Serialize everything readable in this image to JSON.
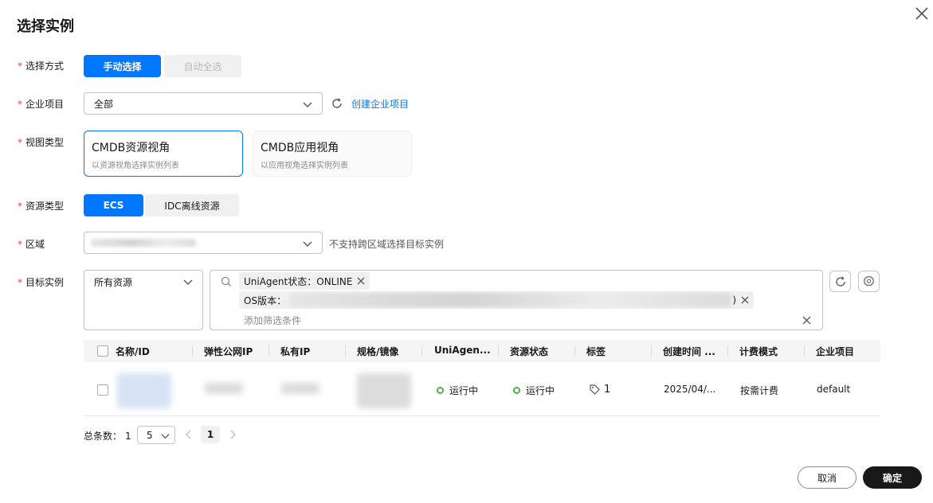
{
  "dialog": {
    "title": "选择实例"
  },
  "selection_mode": {
    "label": "选择方式",
    "options": [
      "手动选择",
      "自动全选"
    ],
    "selected": "手动选择"
  },
  "enterprise_project": {
    "label": "企业项目",
    "value": "全部",
    "create_link": "创建企业项目"
  },
  "view_type": {
    "label": "视图类型",
    "cards": [
      {
        "title": "CMDB资源视角",
        "desc": "以资源视角选择实例列表"
      },
      {
        "title": "CMDB应用视角",
        "desc": "以应用视角选择实例列表"
      }
    ],
    "selected": "CMDB资源视角"
  },
  "resource_type": {
    "label": "资源类型",
    "options": [
      "ECS",
      "IDC离线资源"
    ],
    "selected": "ECS"
  },
  "region": {
    "label": "区域",
    "hint": "不支持跨区域选择目标实例"
  },
  "target_instance": {
    "label": "目标实例",
    "resource_scope": "所有资源",
    "filters": [
      {
        "text": "UniAgent状态：ONLINE"
      },
      {
        "prefix": "OS版本：",
        "suffix": ")"
      }
    ],
    "add_filter_placeholder": "添加筛选条件"
  },
  "table": {
    "columns": [
      "名称/ID",
      "弹性公网IP",
      "私有IP",
      "规格/镜像",
      "UniAgen...",
      "资源状态",
      "标签",
      "创建时间 ...",
      "计费模式",
      "企业项目"
    ],
    "rows": [
      {
        "uniagent_status": "运行中",
        "resource_status": "运行中",
        "tag_count": "1",
        "created": "2025/04/...",
        "billing": "按需计费",
        "enterprise_project": "default"
      }
    ],
    "status_color": "#4caf50"
  },
  "pagination": {
    "total_label": "总条数：",
    "total": "1",
    "page_size": "5",
    "current_page": "1"
  },
  "footer": {
    "cancel": "取消",
    "confirm": "确定"
  },
  "colors": {
    "primary": "#0077ff",
    "required": "#e54545",
    "confirm_button": "#191919"
  }
}
